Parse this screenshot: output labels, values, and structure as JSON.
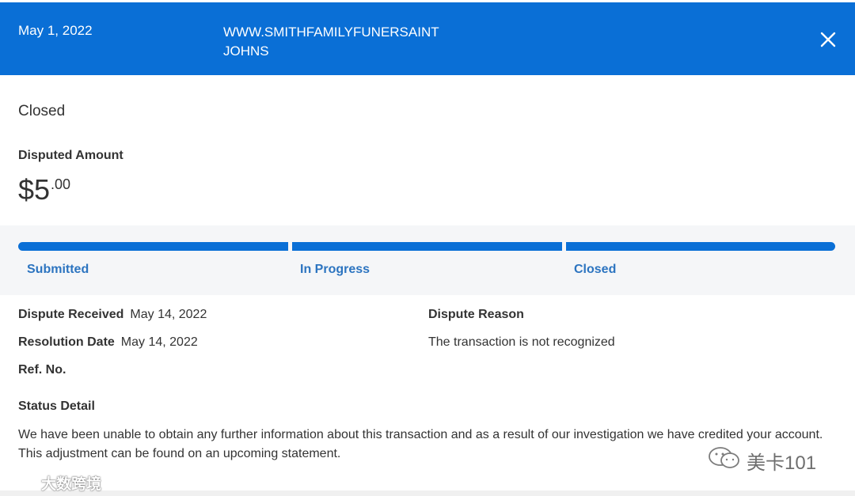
{
  "header": {
    "date": "May 1, 2022",
    "merchant": "WWW.SMITHFAMILYFUNERSAINT JOHNS",
    "close_icon": "close-icon"
  },
  "status": {
    "title": "Closed"
  },
  "amount": {
    "label": "Disputed Amount",
    "whole": "$5",
    "cents": ".00"
  },
  "progress": {
    "steps": [
      {
        "label": "Submitted",
        "complete": true
      },
      {
        "label": "In Progress",
        "complete": true
      },
      {
        "label": "Closed",
        "complete": true
      }
    ],
    "color": "#0a6fd6"
  },
  "details": {
    "dispute_received_label": "Dispute Received",
    "dispute_received_value": "May 14, 2022",
    "resolution_date_label": "Resolution Date",
    "resolution_date_value": "May 14, 2022",
    "ref_no_label": "Ref. No.",
    "dispute_reason_label": "Dispute Reason",
    "dispute_reason_value": "The transaction is not recognized"
  },
  "status_detail": {
    "label": "Status Detail",
    "text": "We have been unable to obtain any further information about this transaction and as a result of our investigation we have credited your account. This adjustment can be found on an upcoming statement."
  },
  "watermarks": {
    "right_text": "美卡101",
    "right_icon": "wechat-icon",
    "left_text": "大数跨境",
    "left_icon": "weibo-icon"
  },
  "colors": {
    "header_bg": "#0a6fd6",
    "step_label": "#2c74c0"
  }
}
